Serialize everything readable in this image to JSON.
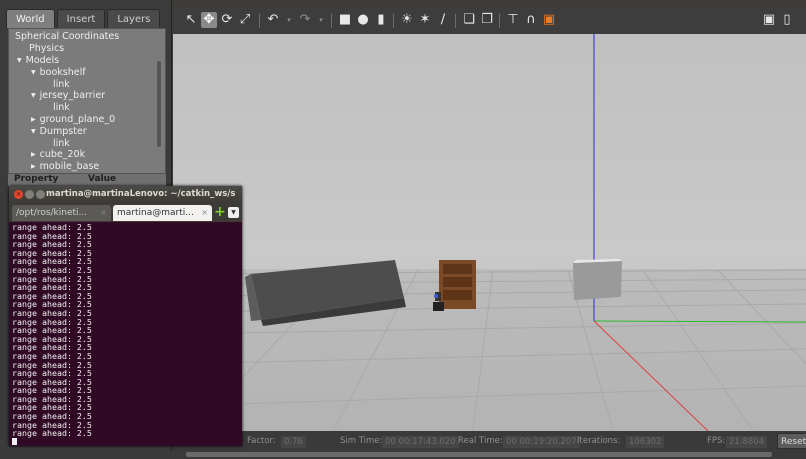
{
  "left_panel": {
    "tabs": [
      "World",
      "Insert",
      "Layers"
    ],
    "active_tab": "World",
    "tree": {
      "items": [
        {
          "label": "Spherical Coordinates",
          "kind": "leaf"
        },
        {
          "label": "Physics",
          "kind": "leaf"
        },
        {
          "label": "Models",
          "kind": "expanded"
        },
        {
          "label": "bookshelf",
          "kind": "expanded"
        },
        {
          "label": "link",
          "kind": "leaf"
        },
        {
          "label": "jersey_barrier",
          "kind": "expanded"
        },
        {
          "label": "link",
          "kind": "leaf"
        },
        {
          "label": "ground_plane_0",
          "kind": "collapsed"
        },
        {
          "label": "Dumpster",
          "kind": "expanded"
        },
        {
          "label": "link",
          "kind": "leaf"
        },
        {
          "label": "cube_20k",
          "kind": "collapsed"
        },
        {
          "label": "mobile_base",
          "kind": "collapsed"
        }
      ]
    },
    "property_header": {
      "property": "Property",
      "value": "Value"
    }
  },
  "toolbar": {
    "icons": [
      "select-arrow-icon",
      "translate-icon",
      "rotate-icon",
      "scale-icon",
      "undo-icon",
      "undo-dropdown-icon",
      "redo-icon",
      "redo-dropdown-icon",
      "box-shape-icon",
      "sphere-shape-icon",
      "cylinder-shape-icon",
      "point-light-icon",
      "spot-light-icon",
      "directional-light-icon",
      "copy-icon",
      "paste-icon",
      "align-icon",
      "snap-icon",
      "color-icon",
      "screenshot-icon",
      "record-icon"
    ]
  },
  "viewport": {
    "axis_colors": {
      "z": "#2828e6",
      "x": "#e04040",
      "y": "#2dbb2d"
    },
    "models": [
      "jersey_barrier",
      "bookshelf",
      "cube_20k",
      "mobile_base"
    ]
  },
  "status_bar": {
    "real_time_factor_label": "Factor:",
    "real_time_factor": "0.76",
    "sim_time_label": "Sim Time:",
    "sim_time": "00 00:17:43.020",
    "real_time_label": "Real Time:",
    "real_time": "00 00:19:20.207",
    "iterations_label": "Iterations:",
    "iterations": "106302",
    "fps_label": "FPS:",
    "fps": "21.8804",
    "reset_label": "Reset"
  },
  "terminal": {
    "title": "martina@martinaLenovo: ~/catkin_ws/s",
    "tabs": [
      {
        "label": "/opt/ros/kineti...",
        "active": false
      },
      {
        "label": "martina@marti...",
        "active": true
      }
    ],
    "line": "range ahead: 2.5",
    "line_count": 25,
    "colors": {
      "background": "#300a24",
      "close": "#e2462f",
      "inactive": "#7f7e79"
    }
  }
}
